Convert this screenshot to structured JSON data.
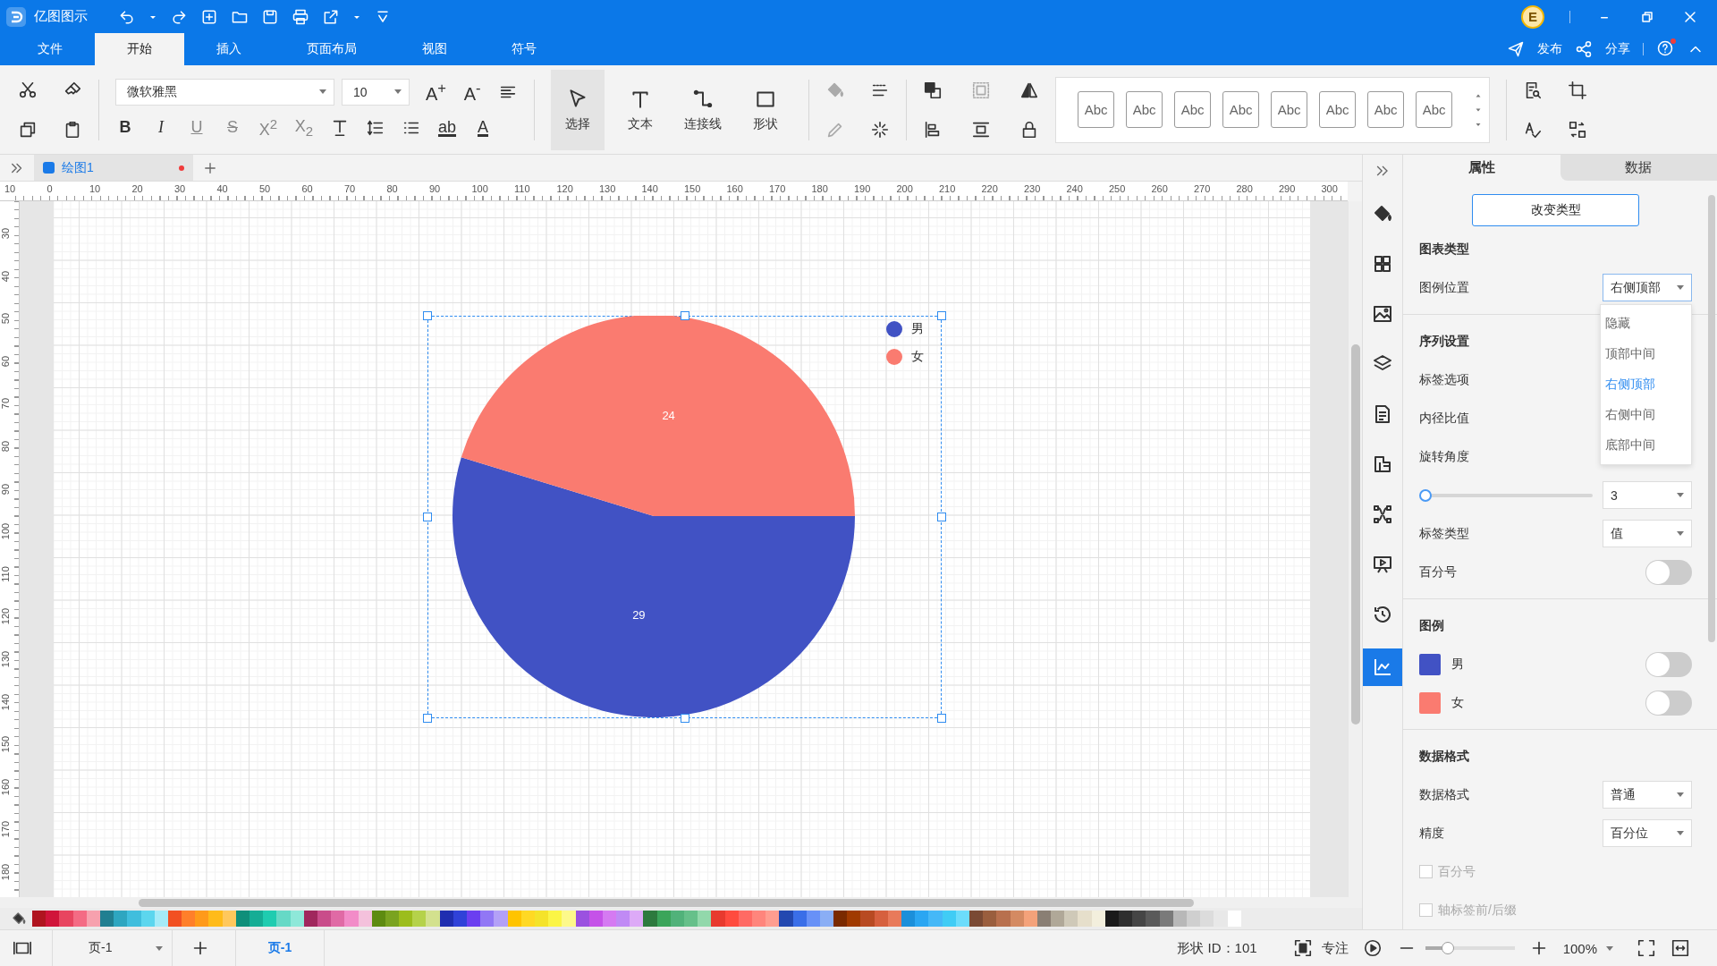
{
  "app": {
    "name": "亿图图示",
    "avatar": "E",
    "actions": [
      "发布",
      "分享"
    ]
  },
  "ribbon_tabs": [
    {
      "label": "文件",
      "selected": false
    },
    {
      "label": "开始",
      "selected": true
    },
    {
      "label": "插入",
      "selected": false
    },
    {
      "label": "页面布局",
      "selected": false
    },
    {
      "label": "视图",
      "selected": false
    },
    {
      "label": "符号",
      "selected": false
    }
  ],
  "toolbar": {
    "font": "微软雅黑",
    "font_size": "10",
    "size_glyphs": [
      "A$^{+}$",
      "A$^{-}$"
    ],
    "format_glyphs": [
      "B",
      "I",
      "U",
      "S",
      "X$^{2}$",
      "X$_{2}$"
    ],
    "color_glyphs": [
      "ab",
      "A"
    ],
    "tools": [
      {
        "label": "选择",
        "selected": true
      },
      {
        "label": "文本",
        "selected": false
      },
      {
        "label": "连接线",
        "selected": false
      },
      {
        "label": "形状",
        "selected": false
      }
    ],
    "styles": [
      "Abc",
      "Abc",
      "Abc",
      "Abc",
      "Abc",
      "Abc",
      "Abc",
      "Abc"
    ]
  },
  "document_tabs": [
    {
      "label": "绘图1",
      "unsaved": true,
      "selected": true
    }
  ],
  "rulers": {
    "horizontal": [
      "10",
      "0",
      "10",
      "20",
      "30",
      "40",
      "50",
      "60",
      "70",
      "80",
      "90",
      "100",
      "110",
      "120",
      "130",
      "140",
      "150",
      "160",
      "170",
      "180",
      "190",
      "200",
      "210",
      "220",
      "230",
      "240",
      "250",
      "260",
      "270",
      "280",
      "290",
      "300"
    ],
    "vertical": [
      "30",
      "40",
      "50",
      "60",
      "70",
      "80",
      "90",
      "100",
      "110",
      "120",
      "130",
      "140",
      "150",
      "160",
      "170",
      "180"
    ]
  },
  "chart": {
    "selected": true,
    "slices": [
      {
        "color": "#4152c4"
      },
      {
        "color": "#fa7b70"
      }
    ],
    "chart_data": {
      "type": "pie",
      "categories": [
        "男",
        "女"
      ],
      "values": [
        29,
        24
      ],
      "data_labels": true,
      "legend": "top-right"
    }
  },
  "panel": {
    "tabs": [
      {
        "label": "属性",
        "selected": true
      },
      {
        "label": "数据",
        "selected": false
      }
    ],
    "change_type_button": "改变类型",
    "chart_type": {
      "title": "图表类型",
      "legend_position": {
        "label": "图例位置",
        "value": "右侧顶部",
        "expanded": true,
        "options": [
          {
            "label": "隐藏",
            "selected": false
          },
          {
            "label": "顶部中间",
            "selected": false
          },
          {
            "label": "右侧顶部",
            "selected": true
          },
          {
            "label": "右侧中间",
            "selected": false
          },
          {
            "label": "底部中间",
            "selected": false
          }
        ]
      }
    },
    "series_settings": {
      "title": "序列设置",
      "labels": [
        "标签选项",
        "内径比值",
        "旋转角度"
      ],
      "rotation": {
        "level": 0,
        "value": "3"
      },
      "label_type": {
        "label": "标签类型",
        "value": "值"
      },
      "percent": {
        "label": "百分号",
        "on": false
      }
    },
    "legend": {
      "title": "图例",
      "items": [
        {
          "label": "男",
          "color": "#4152c4",
          "on": false
        },
        {
          "label": "女",
          "color": "#fa7b70",
          "on": false
        }
      ]
    },
    "data_format": {
      "title": "数据格式",
      "format": {
        "label": "数据格式",
        "value": "普通"
      },
      "precision": {
        "label": "精度",
        "value": "百分位"
      },
      "checks": [
        {
          "label": "百分号",
          "checked": false,
          "disabled": true
        },
        {
          "label": "轴标签前/后缀",
          "checked": false,
          "disabled": true
        }
      ]
    }
  },
  "palette": [
    {
      "color": "#b0141f"
    },
    {
      "color": "#d0143a"
    },
    {
      "color": "#e84560"
    },
    {
      "color": "#f46b84"
    },
    {
      "color": "#f7a1ae"
    },
    {
      "color": "#217f91"
    },
    {
      "color": "#2ea6c0"
    },
    {
      "color": "#40bedd"
    },
    {
      "color": "#5cd6ee"
    },
    {
      "color": "#a5ebf8"
    },
    {
      "color": "#f25022"
    },
    {
      "color": "#ff7f2a"
    },
    {
      "color": "#ff9a1a"
    },
    {
      "color": "#ffbb1a"
    },
    {
      "color": "#ffc85c"
    },
    {
      "color": "#0f8f7a"
    },
    {
      "color": "#15ad95"
    },
    {
      "color": "#1fccb0"
    },
    {
      "color": "#66d9c6"
    },
    {
      "color": "#8ee8d9"
    },
    {
      "color": "#a0275d"
    },
    {
      "color": "#c94c8a"
    },
    {
      "color": "#e06aa5"
    },
    {
      "color": "#f28cc8"
    },
    {
      "color": "#f4c1dc"
    },
    {
      "color": "#5e8b10"
    },
    {
      "color": "#7aa320"
    },
    {
      "color": "#9cbd1c"
    },
    {
      "color": "#b5d24a"
    },
    {
      "color": "#d3e18e"
    },
    {
      "color": "#1f2eb0"
    },
    {
      "color": "#3042d8"
    },
    {
      "color": "#6b3ff0"
    },
    {
      "color": "#9177f5"
    },
    {
      "color": "#b3a0f7"
    },
    {
      "color": "#ffc400"
    },
    {
      "color": "#ffd924"
    },
    {
      "color": "#f5e32a"
    },
    {
      "color": "#fbf546"
    },
    {
      "color": "#fdf98a"
    },
    {
      "color": "#9b51e0"
    },
    {
      "color": "#c552e8"
    },
    {
      "color": "#d57af2"
    },
    {
      "color": "#c08af5"
    },
    {
      "color": "#ddaaf7"
    },
    {
      "color": "#2d7a3e"
    },
    {
      "color": "#3ba55a"
    },
    {
      "color": "#51b27a"
    },
    {
      "color": "#66c08a"
    },
    {
      "color": "#92d8ab"
    },
    {
      "color": "#e83a2e"
    },
    {
      "color": "#ff4b3e"
    },
    {
      "color": "#ff6a64"
    },
    {
      "color": "#ff857c"
    },
    {
      "color": "#ff9d90"
    },
    {
      "color": "#2348b0"
    },
    {
      "color": "#3a6ee8"
    },
    {
      "color": "#6891f7"
    },
    {
      "color": "#8aaef5"
    },
    {
      "color": "#7a2a00"
    },
    {
      "color": "#a03a00"
    },
    {
      "color": "#b84a22"
    },
    {
      "color": "#d6603e"
    },
    {
      "color": "#e87a5a"
    },
    {
      "color": "#1b8fda"
    },
    {
      "color": "#2aa6f2"
    },
    {
      "color": "#45b8f7"
    },
    {
      "color": "#40ccf5"
    },
    {
      "color": "#6cdcfb"
    },
    {
      "color": "#7a4a34"
    },
    {
      "color": "#9a5e3e"
    },
    {
      "color": "#b8704e"
    },
    {
      "color": "#d48a62"
    },
    {
      "color": "#f4a27a"
    },
    {
      "color": "#8a7f74"
    },
    {
      "color": "#b0a898"
    },
    {
      "color": "#cfc9b8"
    },
    {
      "color": "#e6dfcb"
    },
    {
      "color": "#f3efdd"
    },
    {
      "color": "#1a1a1a"
    },
    {
      "color": "#2e2e2e"
    },
    {
      "color": "#454545"
    },
    {
      "color": "#5a5a5a"
    },
    {
      "color": "#7a7a7a"
    },
    {
      "color": "#b8b8b8"
    },
    {
      "color": "#cfcfcf"
    },
    {
      "color": "#dcdcdc"
    },
    {
      "color": "#e8e8e8"
    },
    {
      "color": "#ffffff"
    }
  ],
  "status_bar": {
    "page_select": "页-1",
    "pages": [
      {
        "label": "页-1",
        "selected": true
      }
    ],
    "shape_id": "形状 ID：101",
    "focus": "专注",
    "zoom": {
      "level": 0.25,
      "value": "100%"
    }
  }
}
